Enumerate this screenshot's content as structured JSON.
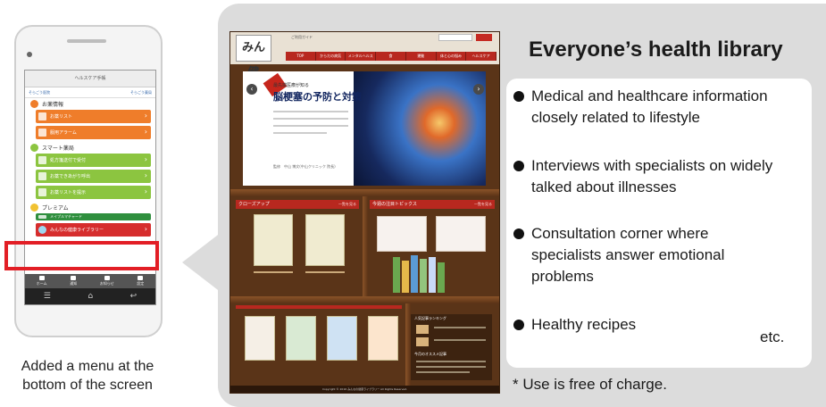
{
  "phone": {
    "app_title": "ヘルスケア手帳",
    "header_links": [
      "そらごう医院",
      "そらごう薬局"
    ],
    "sections": [
      {
        "label": "お薬情報",
        "items": [
          "お薬リスト",
          "服用アラーム"
        ]
      },
      {
        "label": "スマート薬局",
        "items": [
          "処方箋送付で受付",
          "お薬できあがり呼出",
          "お薬リストを提示"
        ]
      },
      {
        "label": "プレミアム",
        "items": [
          "メイプルマチャード",
          "みんなの健康ライブラリー"
        ]
      }
    ],
    "tabs": [
      "ホーム",
      "通知",
      "お知らせ",
      "設定"
    ],
    "softkeys": [
      "☰",
      "⌂",
      "↩"
    ]
  },
  "caption": {
    "line1": "Added a menu at the",
    "line2": "bottom of the screen"
  },
  "website": {
    "logo": "みん健",
    "tagline": "ご利用ガイド",
    "nav": [
      "TOP",
      "からだの病気",
      "メンタルヘルス",
      "食",
      "運動",
      "体と心の悩み",
      "ヘルスケア"
    ],
    "banner": {
      "subtitle": "最先端医療が知る",
      "title": "脳梗塞の予防と対策",
      "credit": "監修　中山 博文(中山クリニック 院長)"
    },
    "sections": [
      "クローズアップ",
      "今週の注目トピックス"
    ],
    "more_label": "一覧を見る",
    "ranking_label": "人気記事ランキング",
    "pick_label": "今月のオススメ記事",
    "footer": "Copyright © 2016 みんなの健康ライブラリー All Rights Reserved."
  },
  "info": {
    "title": "Everyone’s health library",
    "features": [
      "Medical and healthcare information closely related to lifestyle",
      "Interviews with specialists on widely talked about illnesses",
      "Consultation corner where specialists answer emotional problems",
      "Healthy recipes"
    ],
    "etc": "etc.",
    "note": "* Use is free of charge."
  },
  "colors": {
    "highlight": "#e21e25",
    "menu_orange": "#ef7d2a",
    "menu_green": "#8cc540",
    "menu_red": "#d62d2d",
    "site_accent": "#b8281f",
    "shelf_wood": "#5a3418",
    "panel": "#dcdcdc"
  }
}
